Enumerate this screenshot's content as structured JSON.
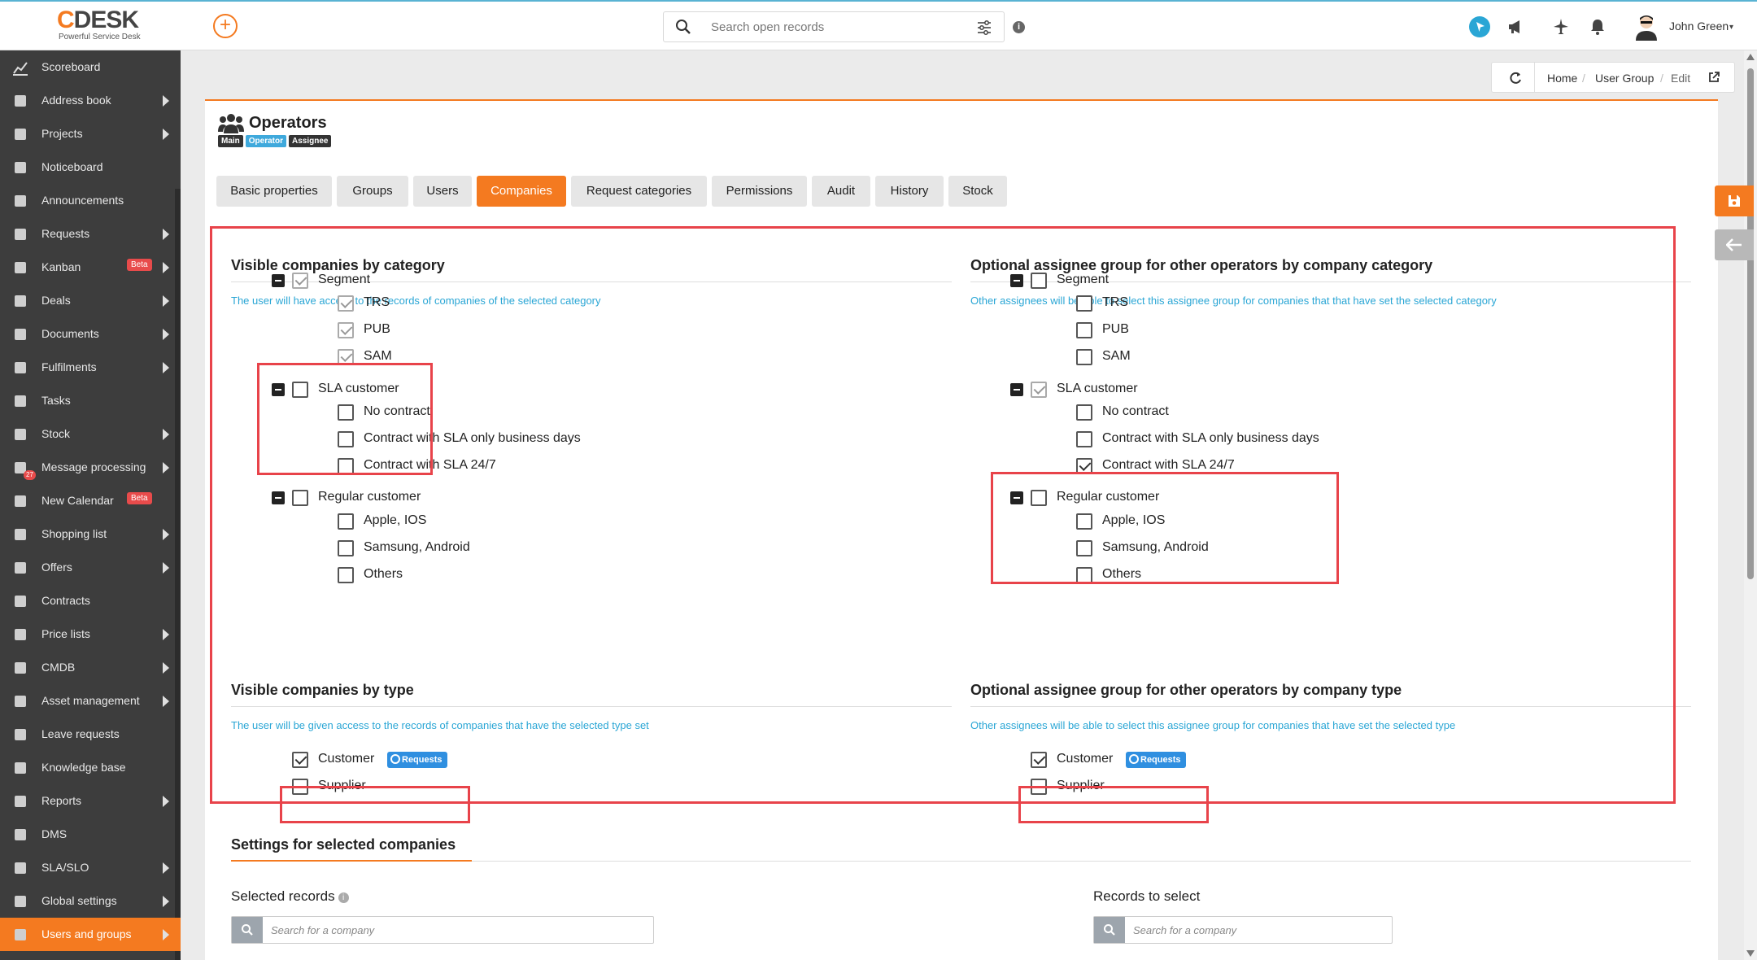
{
  "logo": {
    "brand_c": "C",
    "brand_rest": "DESK",
    "tagline": "Powerful Service Desk"
  },
  "topbar": {
    "add_symbol": "+",
    "search_placeholder": "Search open records",
    "info_symbol": "i",
    "user_name": "John Green",
    "user_caret": "▾"
  },
  "sidebar": {
    "items": [
      {
        "label": "Scoreboard",
        "icon": "chart-line-icon",
        "arrow": false
      },
      {
        "label": "Address book",
        "icon": "address-book-icon",
        "arrow": true
      },
      {
        "label": "Projects",
        "icon": "projects-icon",
        "arrow": true
      },
      {
        "label": "Noticeboard",
        "icon": "pin-icon",
        "arrow": false
      },
      {
        "label": "Announcements",
        "icon": "megaphone-icon",
        "arrow": false
      },
      {
        "label": "Requests",
        "icon": "requests-icon",
        "arrow": true
      },
      {
        "label": "Kanban",
        "icon": "kanban-icon",
        "arrow": true,
        "badge": "Beta"
      },
      {
        "label": "Deals",
        "icon": "briefcase-icon",
        "arrow": true
      },
      {
        "label": "Documents",
        "icon": "documents-icon",
        "arrow": true
      },
      {
        "label": "Fulfilments",
        "icon": "fulfilments-icon",
        "arrow": true
      },
      {
        "label": "Tasks",
        "icon": "tasks-icon",
        "arrow": false
      },
      {
        "label": "Stock",
        "icon": "stock-icon",
        "arrow": true
      },
      {
        "label": "Message processing",
        "icon": "mail-icon",
        "arrow": true,
        "count": "27"
      },
      {
        "label": "New Calendar",
        "icon": "calendar-icon",
        "arrow": false,
        "badge": "Beta"
      },
      {
        "label": "Shopping list",
        "icon": "cart-icon",
        "arrow": true
      },
      {
        "label": "Offers",
        "icon": "tag-icon",
        "arrow": true
      },
      {
        "label": "Contracts",
        "icon": "contract-icon",
        "arrow": false
      },
      {
        "label": "Price lists",
        "icon": "price-list-icon",
        "arrow": true
      },
      {
        "label": "CMDB",
        "icon": "folder-icon",
        "arrow": true
      },
      {
        "label": "Asset management",
        "icon": "asset-icon",
        "arrow": true
      },
      {
        "label": "Leave requests",
        "icon": "plane-icon",
        "arrow": false
      },
      {
        "label": "Knowledge base",
        "icon": "book-icon",
        "arrow": false
      },
      {
        "label": "Reports",
        "icon": "bar-chart-icon",
        "arrow": true
      },
      {
        "label": "DMS",
        "icon": "database-icon",
        "arrow": false
      },
      {
        "label": "SLA/SLO",
        "icon": "gavel-icon",
        "arrow": true
      },
      {
        "label": "Global settings",
        "icon": "gears-icon",
        "arrow": true
      },
      {
        "label": "Users and groups",
        "icon": "users-icon",
        "arrow": true,
        "active": true
      }
    ]
  },
  "breadcrumb": {
    "home": "Home",
    "sep": "/",
    "group": "User Group",
    "edit": "Edit"
  },
  "page": {
    "title": "Operators",
    "tags": [
      "Main",
      "Operator",
      "Assignee"
    ],
    "tabs": [
      "Basic properties",
      "Groups",
      "Users",
      "Companies",
      "Request categories",
      "Permissions",
      "Audit",
      "History",
      "Stock"
    ],
    "active_tab": "Companies"
  },
  "sections": {
    "vis_cat": {
      "title": "Visible companies by category",
      "desc": "The user will have access to the records of companies of the selected category"
    },
    "opt_cat": {
      "title": "Optional assignee group for other operators by company category",
      "desc": "Other assignees will be able to select this assignee group for companies that that have set the selected category"
    },
    "vis_type": {
      "title": "Visible companies by type",
      "desc": "The user will be given access to the records of companies that have the selected type set"
    },
    "opt_type": {
      "title": "Optional assignee group for other operators by company type",
      "desc": "Other assignees will be able to select this assignee group for companies that have set the selected type"
    },
    "settings": {
      "title": "Settings for selected companies"
    }
  },
  "tree": {
    "segment": "Segment",
    "trs": "TRS",
    "pub": "PUB",
    "sam": "SAM",
    "sla": "SLA customer",
    "no_contract": "No contract",
    "sla_business": "Contract with SLA only business days",
    "sla_247": "Contract with SLA 24/7",
    "regular": "Regular customer",
    "apple": "Apple, IOS",
    "samsung": "Samsung, Android",
    "others": "Others"
  },
  "left_checks": {
    "segment": true,
    "trs": true,
    "pub": true,
    "sam": true,
    "sla": false,
    "no_contract": false,
    "sla_business": false,
    "sla_247": false,
    "regular": false,
    "apple": false,
    "samsung": false,
    "others": false
  },
  "right_checks": {
    "segment": false,
    "trs": false,
    "pub": false,
    "sam": false,
    "sla": true,
    "no_contract": false,
    "sla_business": false,
    "sla_247": true,
    "regular": false,
    "apple": false,
    "samsung": false,
    "others": false
  },
  "types": {
    "customer": "Customer",
    "supplier": "Supplier",
    "badge": "Requests",
    "left_customer": true,
    "right_customer": true,
    "left_supplier": false,
    "right_supplier": false
  },
  "selection": {
    "selected_label": "Selected records",
    "records_label": "Records to select",
    "search_placeholder": "Search for a company",
    "info_symbol": "i"
  },
  "colors": {
    "accent": "#f47a20",
    "link": "#2aa6d5",
    "highlight": "#e8434a",
    "sidebar": "#3d3d3d",
    "badge_blue": "#2f8fe0"
  }
}
